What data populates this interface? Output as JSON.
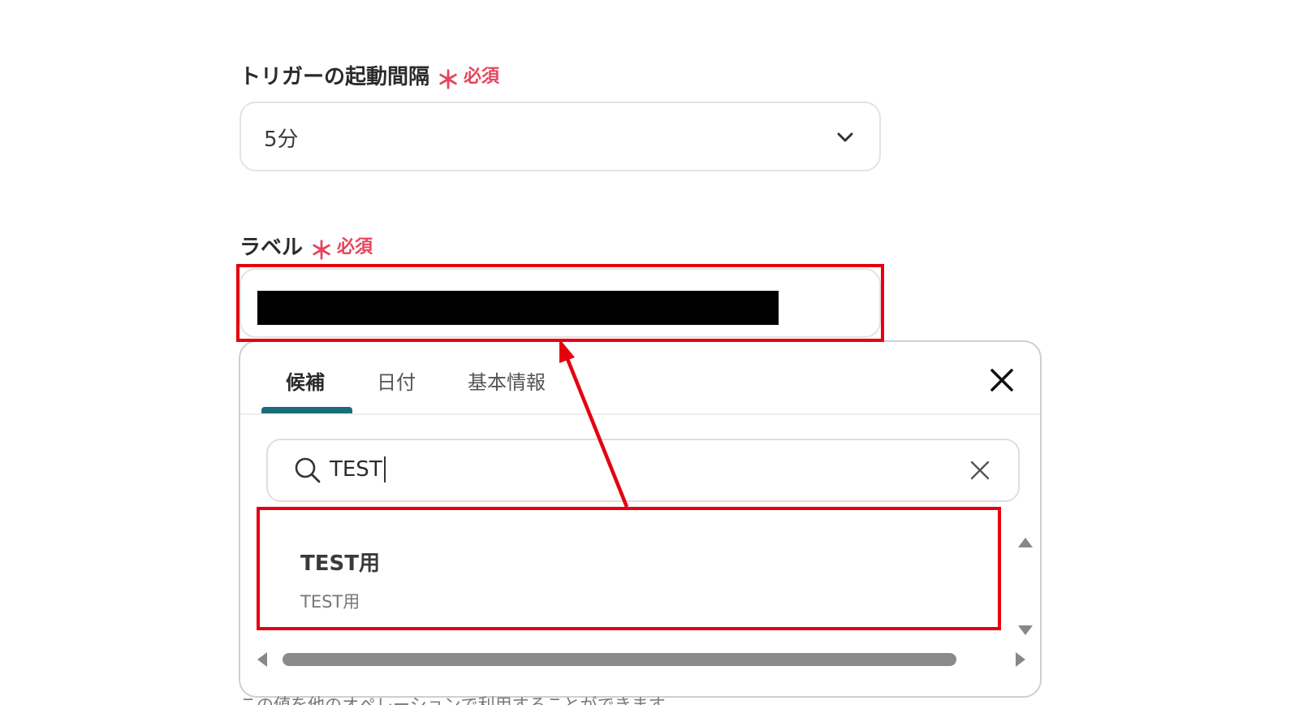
{
  "trigger_interval": {
    "label": "トリガーの起動間隔",
    "required_mark": "＊",
    "required_text": "必須",
    "selected_value": "5分",
    "chevron_icon": "chevron-down-icon"
  },
  "label_field": {
    "label": "ラベル",
    "required_mark": "＊",
    "required_text": "必須",
    "value_redacted": true
  },
  "picker": {
    "tabs": [
      {
        "label": "候補",
        "active": true
      },
      {
        "label": "日付",
        "active": false
      },
      {
        "label": "基本情報",
        "active": false
      }
    ],
    "close_icon": "close-icon",
    "search": {
      "value": "TEST",
      "search_icon": "search-icon",
      "clear_icon": "clear-icon"
    },
    "results": [
      {
        "title": "TEST用",
        "subtitle": "TEST用"
      }
    ]
  },
  "helper_text": "この値を他のオペレーションで利用することができます。",
  "colors": {
    "required": "#e5455b",
    "tab_accent": "#1b6c78",
    "annotation": "#e6000f"
  }
}
